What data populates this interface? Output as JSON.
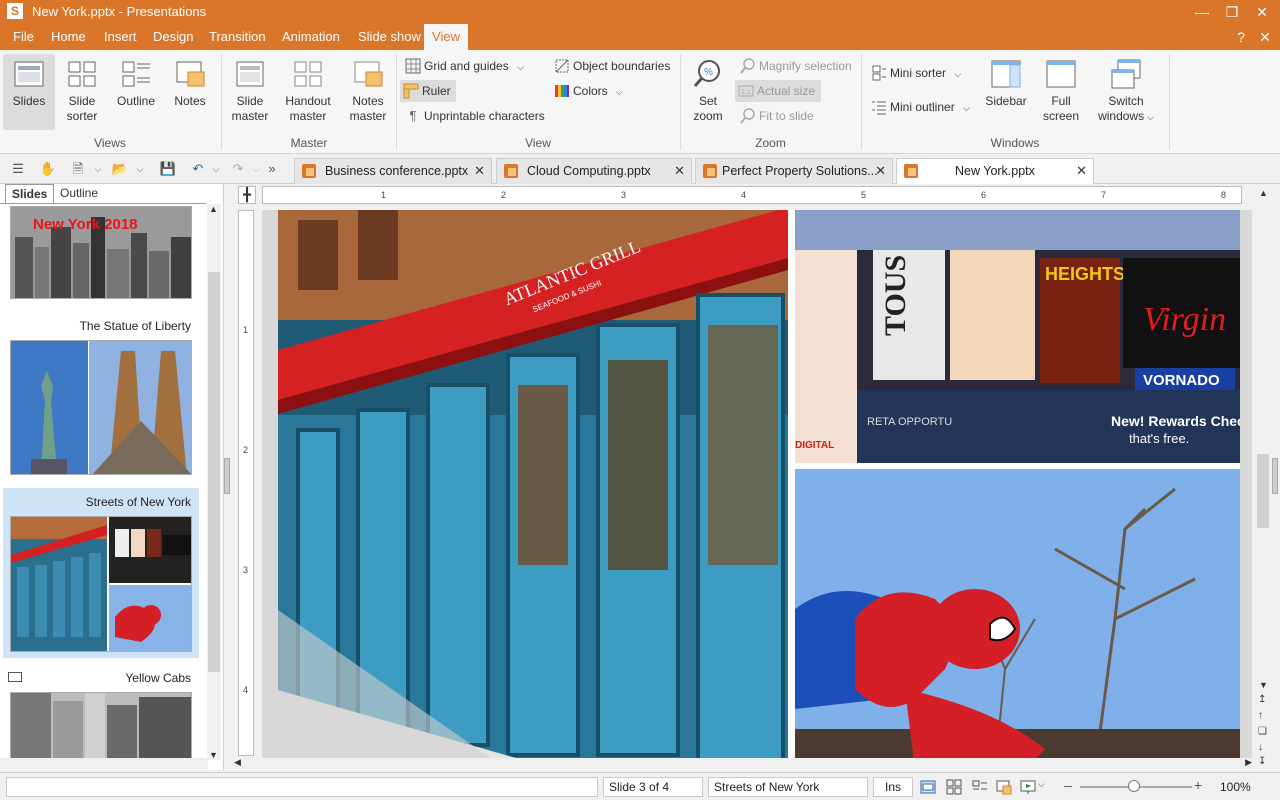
{
  "window": {
    "title": "New York.pptx - Presentations",
    "app_icon_letter": "S",
    "minimize": "—",
    "restore": "❐",
    "close": "✕"
  },
  "menu": {
    "items": [
      "File",
      "Home",
      "Insert",
      "Design",
      "Transition",
      "Animation",
      "Slide show",
      "View"
    ],
    "active": "View",
    "help": "?",
    "close": "✕"
  },
  "ribbon": {
    "views": {
      "label": "Views",
      "slides": "Slides",
      "slide_sorter_1": "Slide",
      "slide_sorter_2": "sorter",
      "outline": "Outline",
      "notes": "Notes"
    },
    "master": {
      "label": "Master",
      "slide_master_1": "Slide",
      "slide_master_2": "master",
      "handout_master_1": "Handout",
      "handout_master_2": "master",
      "notes_master_1": "Notes",
      "notes_master_2": "master"
    },
    "view": {
      "label": "View",
      "grid_and_guides": "Grid and guides",
      "ruler": "Ruler",
      "unprintable": "Unprintable characters",
      "object_boundaries": "Object boundaries",
      "colors": "Colors"
    },
    "zoom": {
      "label": "Zoom",
      "set_zoom_1": "Set",
      "set_zoom_2": "zoom",
      "magnify_selection": "Magnify selection",
      "actual_size": "Actual size",
      "fit_to_slide": "Fit to slide"
    },
    "windows": {
      "label": "Windows",
      "mini_sorter": "Mini sorter",
      "mini_outliner": "Mini outliner",
      "sidebar": "Sidebar",
      "full_screen_1": "Full",
      "full_screen_2": "screen",
      "switch_windows_1": "Switch",
      "switch_windows_2": "windows"
    }
  },
  "doc_tabs": [
    {
      "label": "Business conference.pptx",
      "active": false
    },
    {
      "label": "Cloud Computing.pptx",
      "active": false
    },
    {
      "label": "Perfect Property Solutions...",
      "active": false
    },
    {
      "label": "New York.pptx",
      "active": true
    }
  ],
  "left_panel": {
    "tabs": [
      "Slides",
      "Outline"
    ],
    "active_tab": "Slides",
    "slides": [
      {
        "title": "",
        "banner": "New York 2018"
      },
      {
        "title": "The Statue of Liberty"
      },
      {
        "title": "Streets of New York",
        "selected": true
      },
      {
        "title": "Yellow Cabs"
      }
    ]
  },
  "ruler": {
    "h_numbers": [
      "1",
      "2",
      "3",
      "4",
      "5",
      "6",
      "7",
      "8"
    ],
    "v_numbers": [
      "1",
      "2",
      "3",
      "4"
    ]
  },
  "slide": {
    "signs": {
      "restaurant": "ATLANTIC GRILL",
      "restaurant_sub": "SEAFOOD & SUSHI",
      "board_1": "TOUS",
      "board_2": "HEIGHTS",
      "board_3": "Virgin",
      "board_4": "VORNADO",
      "board_5": "New! Rewards Chec",
      "board_6": "that's free.",
      "board_7": "RETA OPPORTU",
      "board_8": "DIGITAL"
    }
  },
  "status": {
    "slide_pos": "Slide 3 of 4",
    "slide_name": "Streets of New York",
    "mode": "Ins",
    "zoom": "100%",
    "minus": "–",
    "plus": "+"
  },
  "colors": {
    "accent": "#d9762a",
    "selection": "#cfe3f7"
  }
}
